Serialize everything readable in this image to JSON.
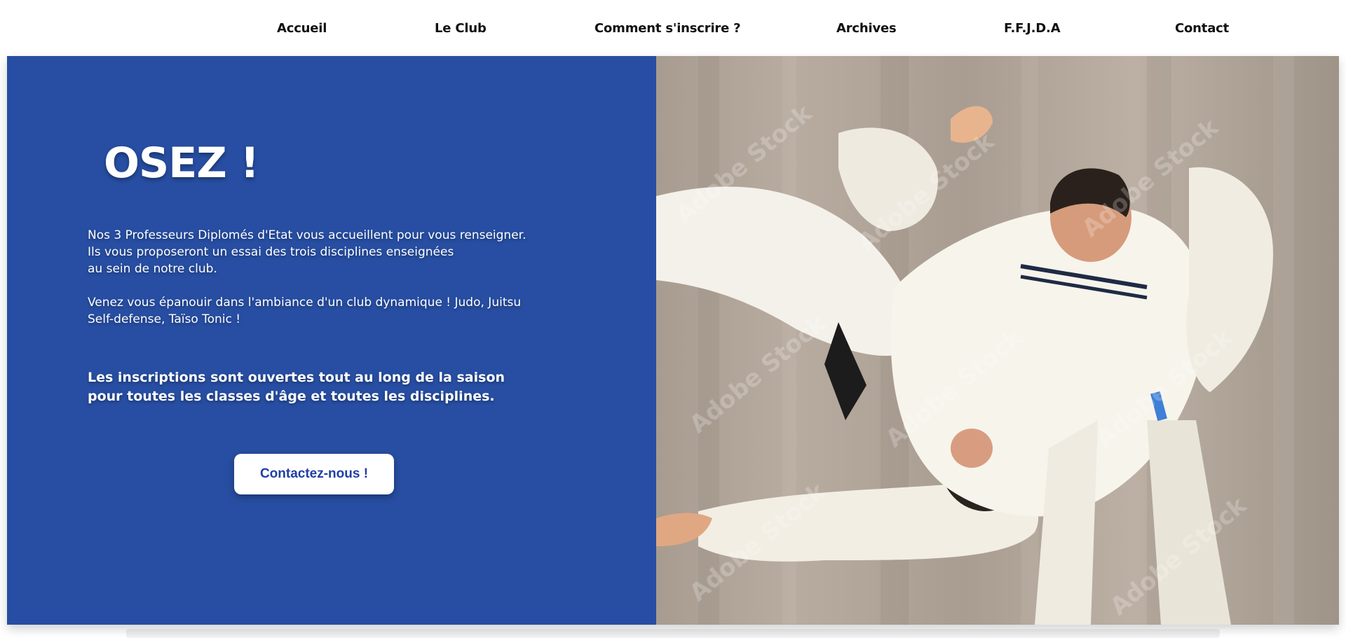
{
  "nav": {
    "items": [
      {
        "label": "Accueil"
      },
      {
        "label": "Le Club"
      },
      {
        "label": "Comment s'inscrire ?"
      },
      {
        "label": "Archives"
      },
      {
        "label": "F.F.J.D.A"
      },
      {
        "label": "Contact"
      }
    ]
  },
  "hero": {
    "headline": "OSEZ !",
    "intro_lines": [
      "Nos 3 Professeurs Diplomés d'Etat vous accueillent pour vous renseigner.",
      "Ils vous proposeront un essai des trois disciplines enseignées",
      "au sein de notre club."
    ],
    "invite_lines": [
      "Venez vous épanouir dans l'ambiance d'un club dynamique ! Judo, Juitsu",
      "Self-defense, Taïso Tonic !"
    ],
    "registration_lines": [
      "Les inscriptions sont ouvertes tout au long de la saison",
      "pour toutes les classes d'âge et toutes les disciplines."
    ],
    "cta_label": "Contactez-nous !",
    "photo_watermark": "Adobe Stock",
    "colors": {
      "panel": "#274ea2",
      "cta_text": "#1f3fa6"
    }
  }
}
